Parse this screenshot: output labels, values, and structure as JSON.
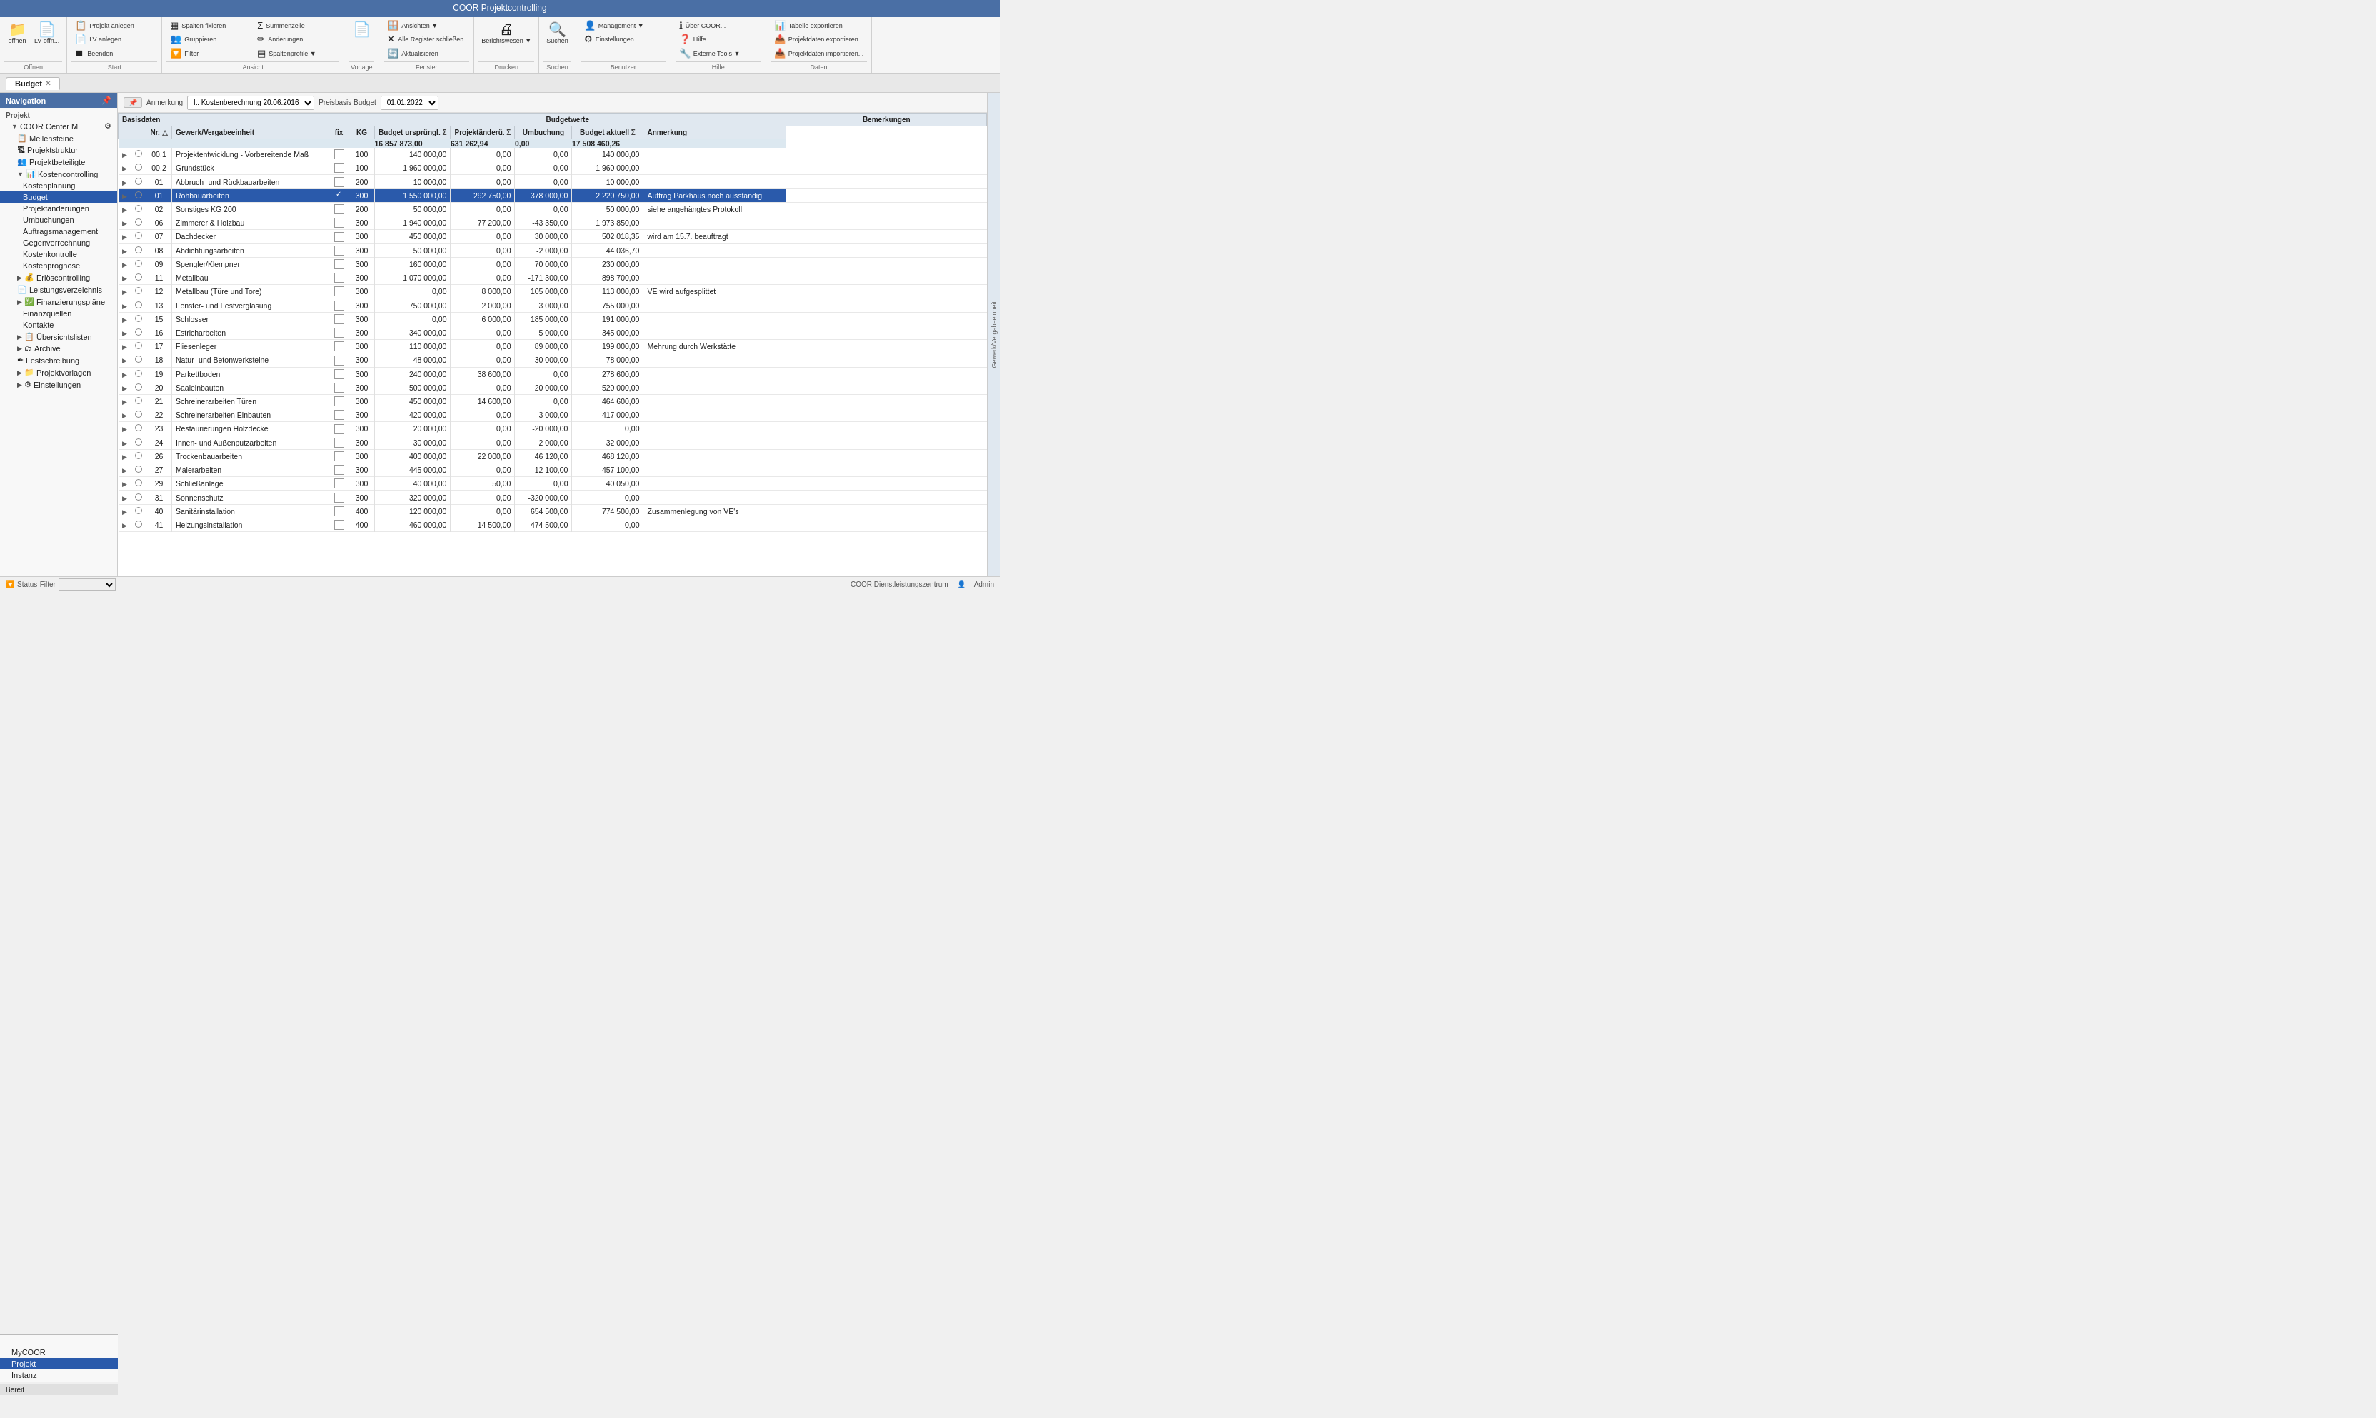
{
  "titleBar": {
    "title": "COOR Projektcontrolling"
  },
  "ribbon": {
    "groups": [
      {
        "label": "Öffnen",
        "buttons": [
          {
            "icon": "📁",
            "label": "öffnen"
          },
          {
            "icon": "📄",
            "label": "LV öffn..."
          }
        ]
      },
      {
        "label": "Start",
        "buttons_col": [
          {
            "icon": "📋",
            "label": "Projekt anlegen"
          },
          {
            "icon": "📄",
            "label": "LV anlegen..."
          },
          {
            "icon": "⏹",
            "label": "Beenden"
          }
        ]
      },
      {
        "label": "Ansicht",
        "buttons_col": [
          {
            "icon": "▦",
            "label": "Spalten fixieren"
          },
          {
            "icon": "👥",
            "label": "Gruppieren"
          },
          {
            "icon": "🔽",
            "label": "Filter"
          },
          {
            "icon": "Σ",
            "label": "Summenzeile"
          },
          {
            "icon": "✏",
            "label": "Änderungen"
          },
          {
            "icon": "▤",
            "label": "Spaltenprofile ▼"
          }
        ]
      },
      {
        "label": "Vorlage",
        "buttons": [
          {
            "icon": "📄",
            "label": ""
          }
        ]
      },
      {
        "label": "Fenster",
        "buttons_col": [
          {
            "icon": "🪟",
            "label": "Ansichten ▼"
          },
          {
            "icon": "✕",
            "label": "Alle Register schließen"
          },
          {
            "icon": "🔄",
            "label": "Aktualisieren"
          }
        ]
      },
      {
        "label": "Drucken",
        "buttons": [
          {
            "icon": "🖨",
            "label": "Berichtswesen ▼"
          }
        ]
      },
      {
        "label": "Suchen",
        "buttons": [
          {
            "icon": "🔍",
            "label": "Suchen"
          }
        ]
      },
      {
        "label": "Benutzer",
        "buttons_col": [
          {
            "icon": "👤",
            "label": "Management ▼"
          },
          {
            "icon": "⚙",
            "label": "Einstellungen"
          }
        ]
      },
      {
        "label": "Hilfe",
        "buttons_col": [
          {
            "icon": "?",
            "label": "Über COOR..."
          },
          {
            "icon": "❓",
            "label": "Hilfe"
          },
          {
            "icon": "🔧",
            "label": "Externe Tools ▼"
          }
        ]
      },
      {
        "label": "Daten",
        "buttons_col": [
          {
            "icon": "📊",
            "label": "Tabelle exportieren"
          },
          {
            "icon": "📤",
            "label": "Projektdaten exportieren..."
          },
          {
            "icon": "📥",
            "label": "Projektdaten importieren..."
          }
        ]
      }
    ]
  },
  "tabs": [
    {
      "label": "Budget",
      "active": true,
      "closable": true
    }
  ],
  "toolbar": {
    "pin_label": "📌",
    "anmerkung_label": "Anmerkung",
    "kostenberechnung_label": "lt. Kostenberechnung 20.06.2016",
    "preisbasis_label": "Preisbasis Budget",
    "preisbasis_value": "01.01.2022"
  },
  "tableHeaders": {
    "basisdaten": "Basisdaten",
    "budgetwerte": "Budgetwerte",
    "bemerkungen": "Bemerkungen",
    "cols": [
      "Nr.",
      "△",
      "Gewerk/Vergabeeinheit",
      "fix",
      "KG",
      "Budget ursprüngl.",
      "Σ",
      "Projektänderu.",
      "Σ",
      "Umbuchung",
      "Budget aktuell",
      "Σ",
      "Anmerkung"
    ]
  },
  "sumRow": {
    "budget_urspruenglich": "16 857 873,00",
    "projektaenderung": "631 262,94",
    "umbuchung": "0,00",
    "budget_aktuell": "17 508 460,26"
  },
  "rows": [
    {
      "nr": "00.1",
      "name": "Projektentwicklung - Vorbereitende Maß",
      "fix": false,
      "kg": "100",
      "budget_urspr": "140 000,00",
      "proj_aend": "0,00",
      "umbuchung": "0,00",
      "budget_akt": "140 000,00",
      "anmerkung": "",
      "selected": false,
      "indent": 0
    },
    {
      "nr": "00.2",
      "name": "Grundstück",
      "fix": false,
      "kg": "100",
      "budget_urspr": "1 960 000,00",
      "proj_aend": "0,00",
      "umbuchung": "0,00",
      "budget_akt": "1 960 000,00",
      "anmerkung": "",
      "selected": false,
      "indent": 0
    },
    {
      "nr": "01",
      "name": "Abbruch- und Rückbauarbeiten",
      "fix": false,
      "kg": "200",
      "budget_urspr": "10 000,00",
      "proj_aend": "0,00",
      "umbuchung": "0,00",
      "budget_akt": "10 000,00",
      "anmerkung": "",
      "selected": false,
      "indent": 0
    },
    {
      "nr": "01",
      "name": "Rohbauarbeiten",
      "fix": true,
      "kg": "300",
      "budget_urspr": "1 550 000,00",
      "proj_aend": "292 750,00",
      "umbuchung": "378 000,00",
      "budget_akt": "2 220 750,00",
      "anmerkung": "Auftrag Parkhaus noch ausständig",
      "selected": true,
      "indent": 0
    },
    {
      "nr": "02",
      "name": "Sonstiges KG 200",
      "fix": false,
      "kg": "200",
      "budget_urspr": "50 000,00",
      "proj_aend": "0,00",
      "umbuchung": "0,00",
      "budget_akt": "50 000,00",
      "anmerkung": "siehe angehängtes Protokoll",
      "selected": false,
      "indent": 0
    },
    {
      "nr": "06",
      "name": "Zimmerer & Holzbau",
      "fix": false,
      "kg": "300",
      "budget_urspr": "1 940 000,00",
      "proj_aend": "77 200,00",
      "umbuchung": "-43 350,00",
      "budget_akt": "1 973 850,00",
      "anmerkung": "",
      "selected": false,
      "indent": 0
    },
    {
      "nr": "07",
      "name": "Dachdecker",
      "fix": false,
      "kg": "300",
      "budget_urspr": "450 000,00",
      "proj_aend": "0,00",
      "umbuchung": "30 000,00",
      "budget_akt": "502 018,35",
      "anmerkung": "wird am 15.7. beauftragt",
      "selected": false,
      "indent": 0
    },
    {
      "nr": "08",
      "name": "Abdichtungsarbeiten",
      "fix": false,
      "kg": "300",
      "budget_urspr": "50 000,00",
      "proj_aend": "0,00",
      "umbuchung": "-2 000,00",
      "budget_akt": "44 036,70",
      "anmerkung": "",
      "selected": false,
      "indent": 0
    },
    {
      "nr": "09",
      "name": "Spengler/Klempner",
      "fix": false,
      "kg": "300",
      "budget_urspr": "160 000,00",
      "proj_aend": "0,00",
      "umbuchung": "70 000,00",
      "budget_akt": "230 000,00",
      "anmerkung": "",
      "selected": false,
      "indent": 0
    },
    {
      "nr": "11",
      "name": "Metallbau",
      "fix": false,
      "kg": "300",
      "budget_urspr": "1 070 000,00",
      "proj_aend": "0,00",
      "umbuchung": "-171 300,00",
      "budget_akt": "898 700,00",
      "anmerkung": "",
      "selected": false,
      "indent": 0
    },
    {
      "nr": "12",
      "name": "Metallbau (Türe und Tore)",
      "fix": false,
      "kg": "300",
      "budget_urspr": "0,00",
      "proj_aend": "8 000,00",
      "umbuchung": "105 000,00",
      "budget_akt": "113 000,00",
      "anmerkung": "VE wird aufgesplittet",
      "selected": false,
      "indent": 0
    },
    {
      "nr": "13",
      "name": "Fenster- und Festverglasung",
      "fix": false,
      "kg": "300",
      "budget_urspr": "750 000,00",
      "proj_aend": "2 000,00",
      "umbuchung": "3 000,00",
      "budget_akt": "755 000,00",
      "anmerkung": "",
      "selected": false,
      "indent": 0
    },
    {
      "nr": "15",
      "name": "Schlosser",
      "fix": false,
      "kg": "300",
      "budget_urspr": "0,00",
      "proj_aend": "6 000,00",
      "umbuchung": "185 000,00",
      "budget_akt": "191 000,00",
      "anmerkung": "",
      "selected": false,
      "indent": 0
    },
    {
      "nr": "16",
      "name": "Estricharbeiten",
      "fix": false,
      "kg": "300",
      "budget_urspr": "340 000,00",
      "proj_aend": "0,00",
      "umbuchung": "5 000,00",
      "budget_akt": "345 000,00",
      "anmerkung": "",
      "selected": false,
      "indent": 0
    },
    {
      "nr": "17",
      "name": "Fliesenleger",
      "fix": false,
      "kg": "300",
      "budget_urspr": "110 000,00",
      "proj_aend": "0,00",
      "umbuchung": "89 000,00",
      "budget_akt": "199 000,00",
      "anmerkung": "Mehrung durch Werkstätte",
      "selected": false,
      "indent": 0
    },
    {
      "nr": "18",
      "name": "Natur- und Betonwerksteine",
      "fix": false,
      "kg": "300",
      "budget_urspr": "48 000,00",
      "proj_aend": "0,00",
      "umbuchung": "30 000,00",
      "budget_akt": "78 000,00",
      "anmerkung": "",
      "selected": false,
      "indent": 0
    },
    {
      "nr": "19",
      "name": "Parkettboden",
      "fix": false,
      "kg": "300",
      "budget_urspr": "240 000,00",
      "proj_aend": "38 600,00",
      "umbuchung": "0,00",
      "budget_akt": "278 600,00",
      "anmerkung": "",
      "selected": false,
      "indent": 0
    },
    {
      "nr": "20",
      "name": "Saaleinbauten",
      "fix": false,
      "kg": "300",
      "budget_urspr": "500 000,00",
      "proj_aend": "0,00",
      "umbuchung": "20 000,00",
      "budget_akt": "520 000,00",
      "anmerkung": "",
      "selected": false,
      "indent": 0
    },
    {
      "nr": "21",
      "name": "Schreinerarbeiten Türen",
      "fix": false,
      "kg": "300",
      "budget_urspr": "450 000,00",
      "proj_aend": "14 600,00",
      "umbuchung": "0,00",
      "budget_akt": "464 600,00",
      "anmerkung": "",
      "selected": false,
      "indent": 0
    },
    {
      "nr": "22",
      "name": "Schreinerarbeiten Einbauten",
      "fix": false,
      "kg": "300",
      "budget_urspr": "420 000,00",
      "proj_aend": "0,00",
      "umbuchung": "-3 000,00",
      "budget_akt": "417 000,00",
      "anmerkung": "",
      "selected": false,
      "indent": 0
    },
    {
      "nr": "23",
      "name": "Restaurierungen Holzdecke",
      "fix": false,
      "kg": "300",
      "budget_urspr": "20 000,00",
      "proj_aend": "0,00",
      "umbuchung": "-20 000,00",
      "budget_akt": "0,00",
      "anmerkung": "",
      "selected": false,
      "indent": 0
    },
    {
      "nr": "24",
      "name": "Innen- und Außenputzarbeiten",
      "fix": false,
      "kg": "300",
      "budget_urspr": "30 000,00",
      "proj_aend": "0,00",
      "umbuchung": "2 000,00",
      "budget_akt": "32 000,00",
      "anmerkung": "",
      "selected": false,
      "indent": 0
    },
    {
      "nr": "26",
      "name": "Trockenbauarbeiten",
      "fix": false,
      "kg": "300",
      "budget_urspr": "400 000,00",
      "proj_aend": "22 000,00",
      "umbuchung": "46 120,00",
      "budget_akt": "468 120,00",
      "anmerkung": "",
      "selected": false,
      "indent": 0
    },
    {
      "nr": "27",
      "name": "Malerarbeiten",
      "fix": false,
      "kg": "300",
      "budget_urspr": "445 000,00",
      "proj_aend": "0,00",
      "umbuchung": "12 100,00",
      "budget_akt": "457 100,00",
      "anmerkung": "",
      "selected": false,
      "indent": 0
    },
    {
      "nr": "29",
      "name": "Schließanlage",
      "fix": false,
      "kg": "300",
      "budget_urspr": "40 000,00",
      "proj_aend": "50,00",
      "umbuchung": "0,00",
      "budget_akt": "40 050,00",
      "anmerkung": "",
      "selected": false,
      "indent": 0
    },
    {
      "nr": "31",
      "name": "Sonnenschutz",
      "fix": false,
      "kg": "300",
      "budget_urspr": "320 000,00",
      "proj_aend": "0,00",
      "umbuchung": "-320 000,00",
      "budget_akt": "0,00",
      "anmerkung": "",
      "selected": false,
      "indent": 0
    },
    {
      "nr": "40",
      "name": "Sanitärinstallation",
      "fix": false,
      "kg": "400",
      "budget_urspr": "120 000,00",
      "proj_aend": "0,00",
      "umbuchung": "654 500,00",
      "budget_akt": "774 500,00",
      "anmerkung": "Zusammenlegung von VE's",
      "selected": false,
      "indent": 0
    },
    {
      "nr": "41",
      "name": "Heizungsinstallation",
      "fix": false,
      "kg": "400",
      "budget_urspr": "460 000,00",
      "proj_aend": "14 500,00",
      "umbuchung": "-474 500,00",
      "budget_akt": "0,00",
      "anmerkung": "",
      "selected": false,
      "indent": 0
    }
  ],
  "sidebar": {
    "header": "Navigation",
    "sections": [
      {
        "label": "Projekt",
        "items": [
          {
            "label": "COOR Center M",
            "level": 1,
            "expand": true,
            "hasGear": true
          },
          {
            "label": "Meilensteine",
            "level": 2,
            "icon": "📋"
          },
          {
            "label": "Projektstruktur",
            "level": 2,
            "icon": "🏗"
          },
          {
            "label": "Projektbeteiligte",
            "level": 2,
            "icon": "👥"
          },
          {
            "label": "Kostencontrolling",
            "level": 2,
            "expand": true,
            "icon": "📊"
          },
          {
            "label": "Kostenplanung",
            "level": 3
          },
          {
            "label": "Budget",
            "level": 3,
            "active": true
          },
          {
            "label": "Projektänderungen",
            "level": 3
          },
          {
            "label": "Umbuchungen",
            "level": 3
          },
          {
            "label": "Auftragsmanagement",
            "level": 3
          },
          {
            "label": "Gegenverrechnung",
            "level": 3
          },
          {
            "label": "Kostenkontrolle",
            "level": 3
          },
          {
            "label": "Kostenprognose",
            "level": 3
          },
          {
            "label": "Erlöscontrolling",
            "level": 2,
            "expand": false,
            "icon": "💰"
          },
          {
            "label": "Leistungsverzeichnis",
            "level": 2,
            "icon": "📄"
          },
          {
            "label": "Finanzierungspläne",
            "level": 2,
            "expand": false,
            "icon": "💹"
          },
          {
            "label": "Finanzquellen",
            "level": 3
          },
          {
            "label": "Kontakte",
            "level": 3
          },
          {
            "label": "Übersichtslisten",
            "level": 2,
            "expand": false,
            "icon": "📋"
          },
          {
            "label": "Archive",
            "level": 2,
            "expand": false,
            "icon": "🗂"
          },
          {
            "label": "Festschreibung",
            "level": 2,
            "icon": "✒"
          },
          {
            "label": "Projektvorlagen",
            "level": 2,
            "expand": false,
            "icon": "📁"
          },
          {
            "label": "Einstellungen",
            "level": 2,
            "expand": false,
            "icon": "⚙"
          }
        ]
      }
    ],
    "bottom": {
      "sections": [
        "MyCOOR",
        "Projekt",
        "Instanz"
      ],
      "active": "Projekt",
      "status": "Bereit"
    }
  },
  "statusBar": {
    "filter_label": "Status-Filter",
    "filter_placeholder": "",
    "right": {
      "dienstleistung": "COOR Dienstleistungszentrum",
      "admin": "Admin"
    }
  },
  "rightPanel": {
    "label": "Gewerk/Vergabeeinheit"
  }
}
